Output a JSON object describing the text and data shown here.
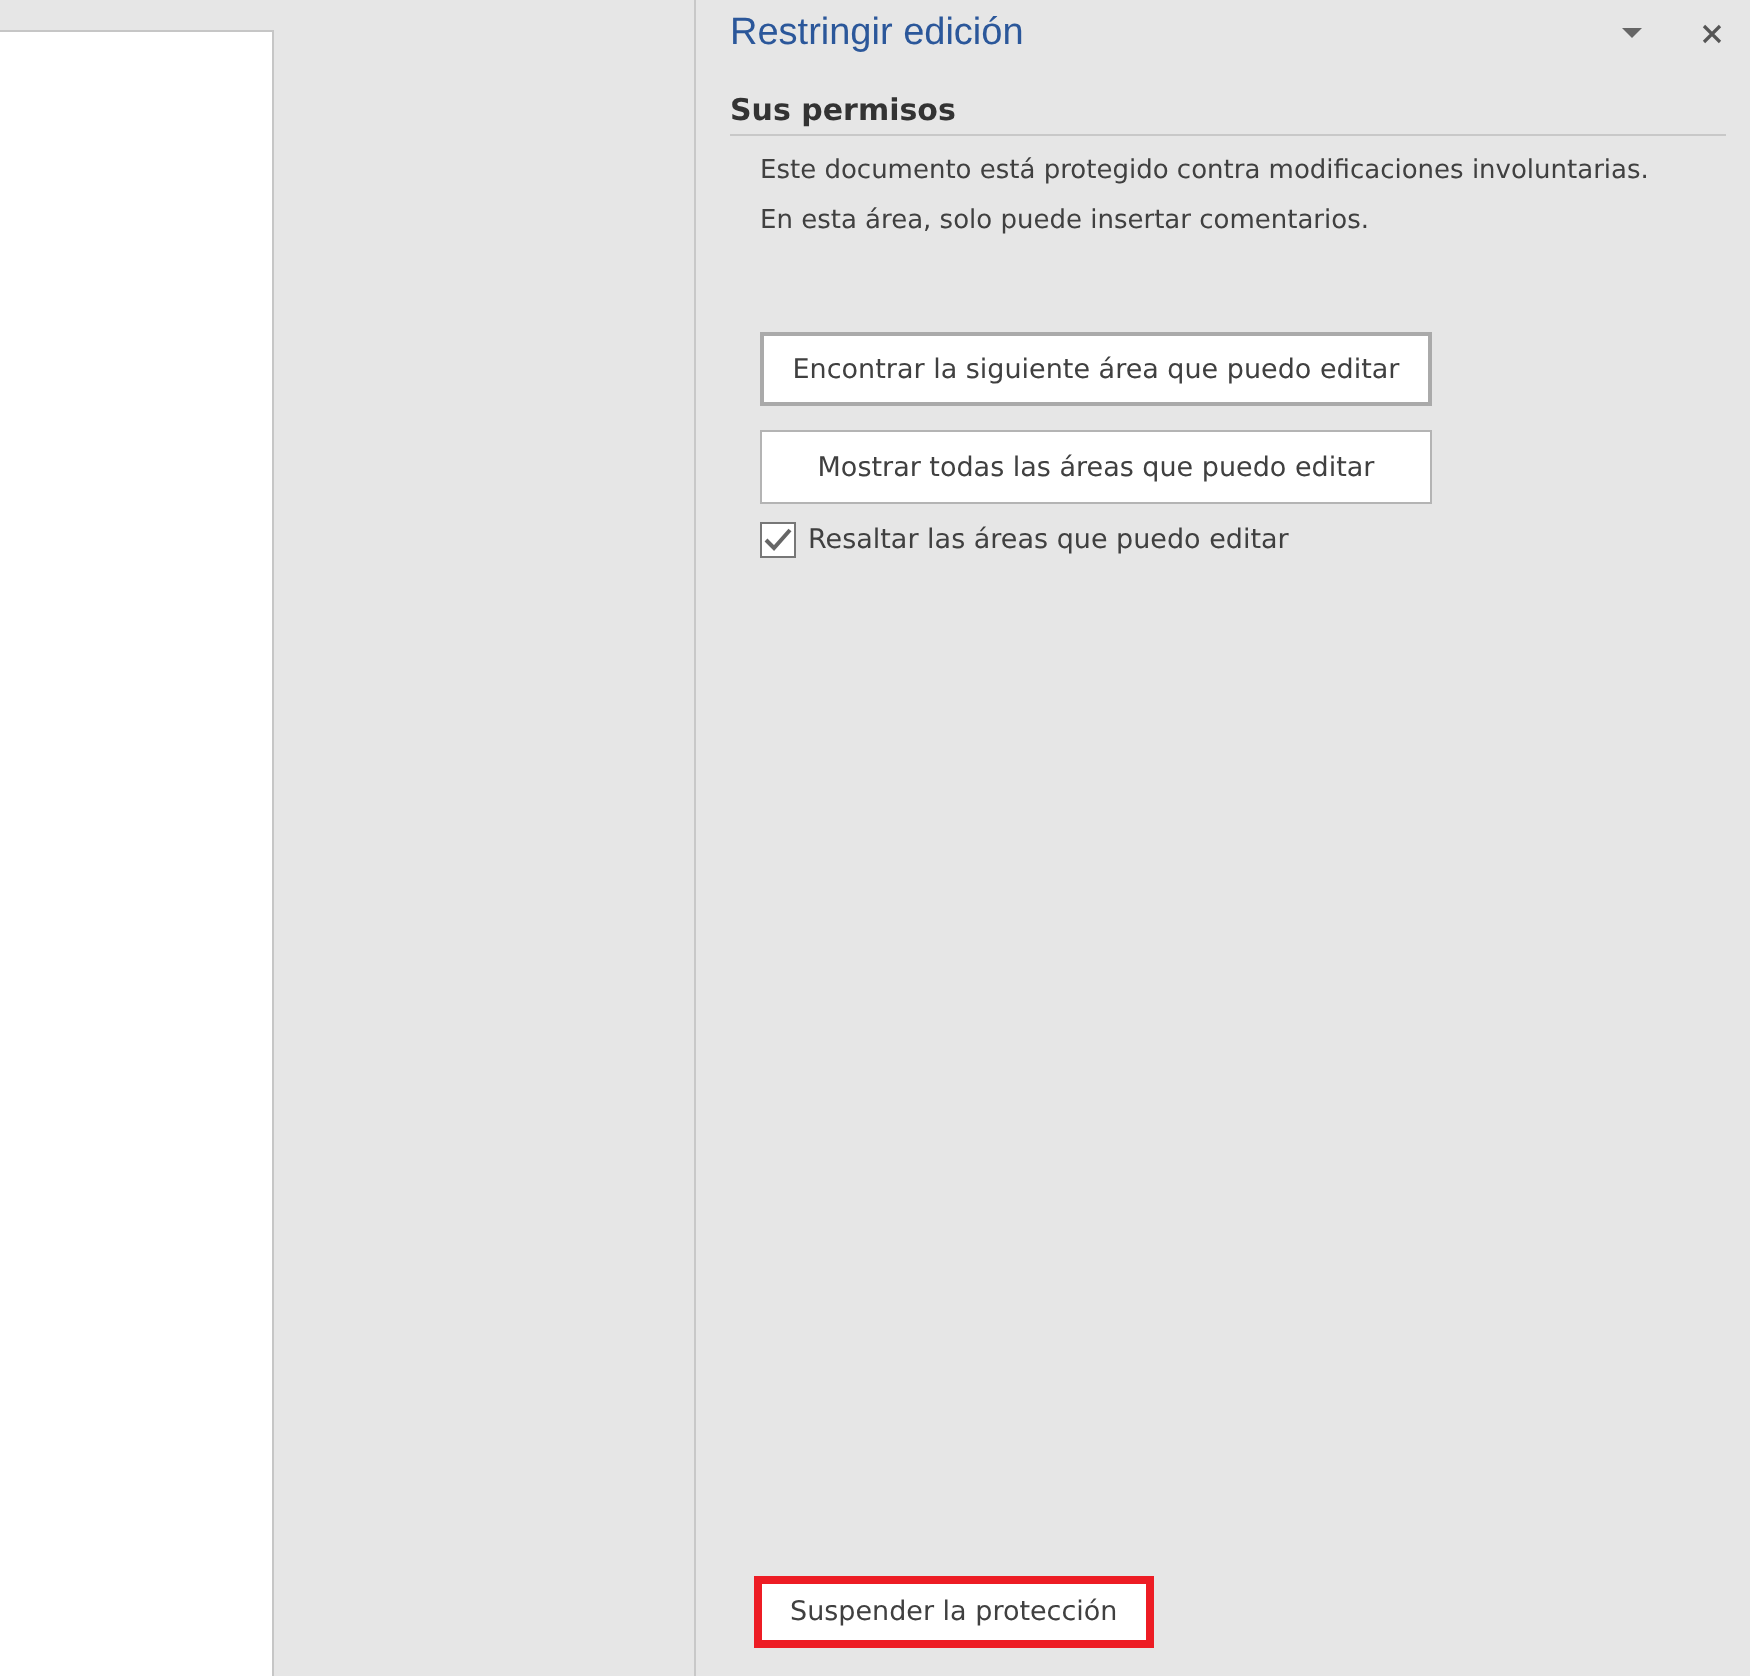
{
  "pane": {
    "title": "Restringir edición",
    "heading": "Sus permisos",
    "paragraph_lines": [
      "Este documento está protegido contra modificaciones involuntarias.",
      "En esta área, solo puede insertar comentarios."
    ],
    "buttons": [
      {
        "label": "Encontrar la siguiente área que puedo editar",
        "focused": true
      },
      {
        "label": "Mostrar todas las áreas que puedo editar",
        "focused": false
      }
    ],
    "checkbox": {
      "label": "Resaltar las áreas que puedo editar",
      "checked": true
    },
    "footer_button": {
      "label": "Suspender la protección",
      "highlighted": true
    }
  }
}
